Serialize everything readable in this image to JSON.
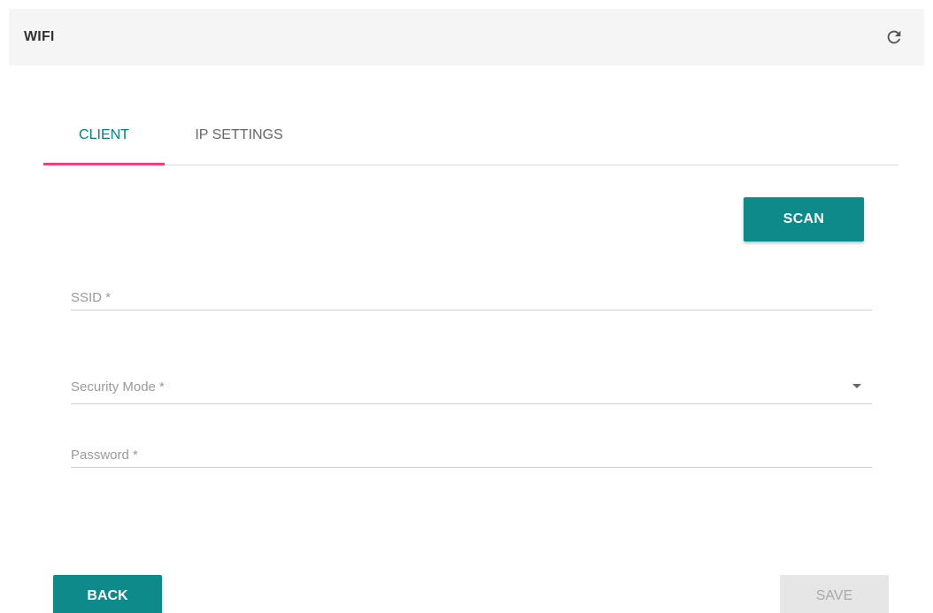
{
  "header": {
    "title": "WIFI",
    "refresh_icon": "refresh-icon"
  },
  "tabs": [
    {
      "label": "CLIENT",
      "active": true
    },
    {
      "label": "IP SETTINGS",
      "active": false
    }
  ],
  "scan": {
    "label": "SCAN"
  },
  "form": {
    "ssid": {
      "label": "SSID *",
      "value": ""
    },
    "security_mode": {
      "label": "Security Mode *",
      "value": "",
      "icon": "dropdown-arrow-icon"
    },
    "password": {
      "label": "Password *",
      "value": ""
    }
  },
  "footer": {
    "back_label": "BACK",
    "save_label": "SAVE",
    "save_enabled": false
  },
  "colors": {
    "accent": "#0f8a8a",
    "tab_active_text": "#008080",
    "tab_indicator": "#f0407a",
    "header_bg": "#f5f5f5",
    "disabled_bg": "#e6e6e6"
  }
}
